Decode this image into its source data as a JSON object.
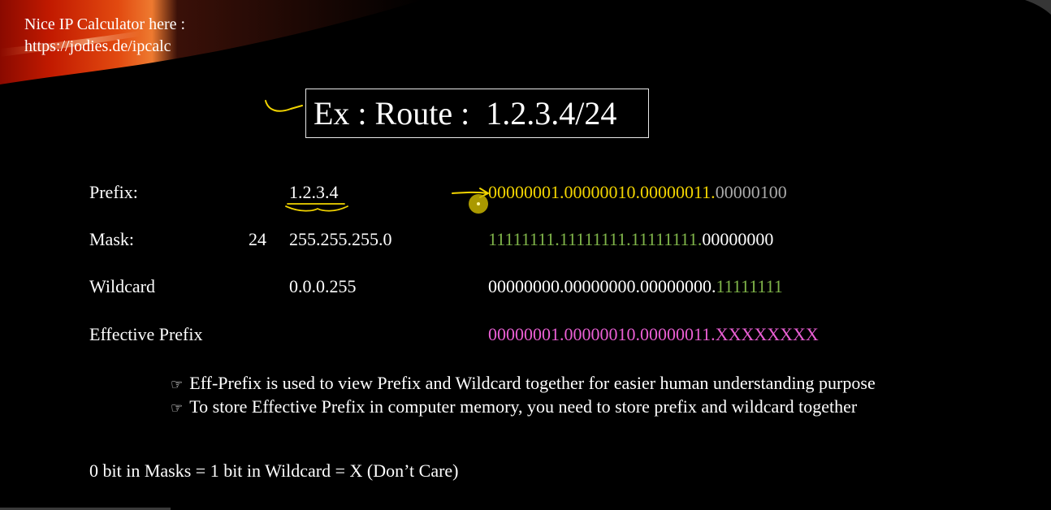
{
  "corner_note": {
    "line1": "Nice IP Calculator here :",
    "line2": "https://jodies.de/ipcalc"
  },
  "title": "Ex : Route :  1.2.3.4/24",
  "rows": {
    "prefix": {
      "label": "Prefix:",
      "value": "1.2.3.4",
      "bits_a": "00000001.00000010.00000011.",
      "bits_b": "00000100"
    },
    "mask": {
      "label": "Mask:",
      "cidr": "24",
      "value": "255.255.255.0",
      "bits_a": "11111111.11111111.11111111.",
      "bits_b": "00000000"
    },
    "wildcard": {
      "label": "Wildcard",
      "value": "0.0.0.255",
      "bits_a": "00000000.00000000.00000000.",
      "bits_b": "11111111"
    },
    "effective": {
      "label": "Effective Prefix",
      "bits_a": "00000001.00000010.00000011.",
      "bits_b": "XXXXXXXX"
    }
  },
  "bullets": [
    "Eff-Prefix is used to view Prefix and Wildcard together for easier human understanding purpose",
    "To store Effective Prefix in computer memory, you need to store prefix and wildcard together"
  ],
  "bullet_icon": "pointing-hand-icon",
  "footer_note": "0 bit in Masks = 1 bit in Wildcard = X (Don’t Care)",
  "colors": {
    "background": "#000000",
    "prefix_bits": "#f2d400",
    "host_bits": "#a9a9a9",
    "mask_bits": "#7fb449",
    "effective_bits": "#ea5fd4",
    "annotation_ink": "#f2d400",
    "cursor_dot": "#c8b400"
  }
}
